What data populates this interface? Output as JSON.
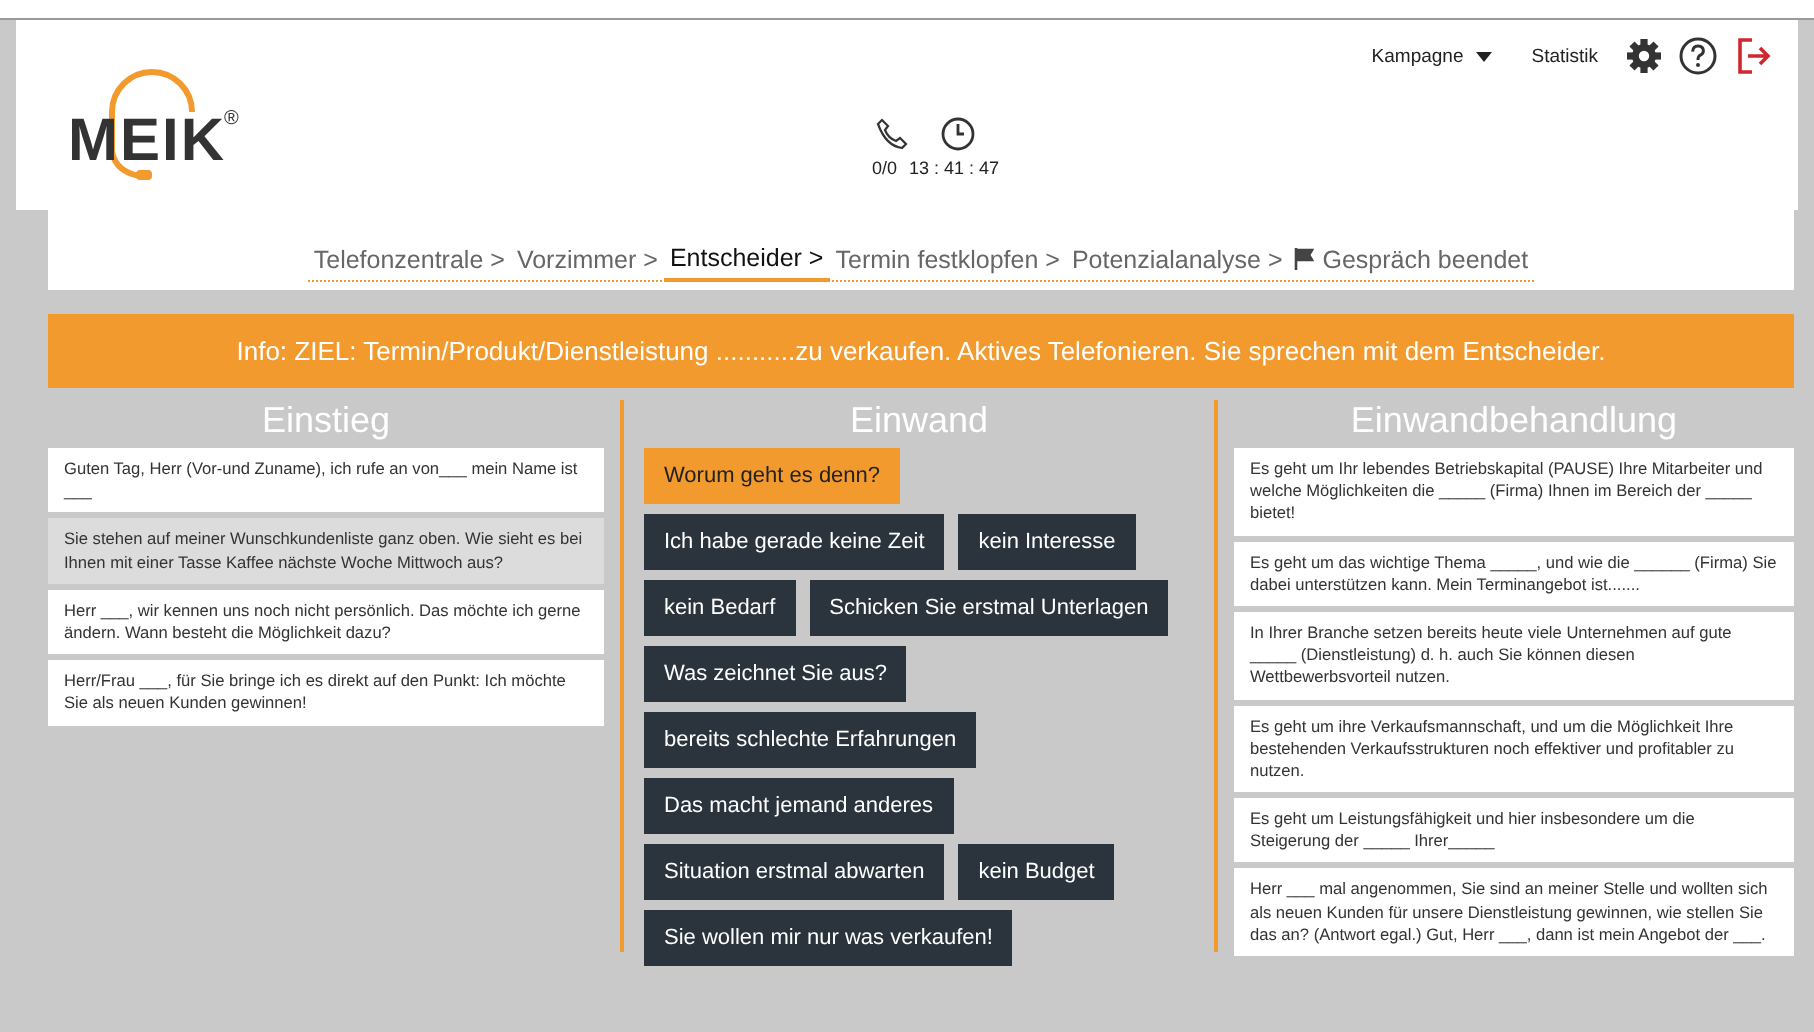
{
  "header": {
    "logo": "MEIK",
    "logo_mark": "®",
    "calls": "0/0",
    "timer": "13 : 41 : 47",
    "menu": [
      {
        "label": "Kampagne",
        "kind": "dropdown"
      },
      {
        "label": "Statistik",
        "kind": "link"
      }
    ]
  },
  "steps": [
    {
      "label": "Telefonzentrale >",
      "selected": false,
      "kind": "step"
    },
    {
      "label": "Vorzimmer >",
      "selected": false,
      "kind": "step"
    },
    {
      "label": "Entscheider >",
      "selected": true,
      "kind": "step"
    },
    {
      "label": "Termin festklopfen >",
      "selected": false,
      "kind": "step"
    },
    {
      "label": "Potenzialanalyse >",
      "selected": false,
      "kind": "step"
    },
    {
      "label": "Gespräch beendet",
      "selected": false,
      "kind": "end"
    }
  ],
  "info": "Info: ZIEL: Termin/Produkt/Dienstleistung ...........zu verkaufen. Aktives Telefonieren. Sie sprechen mit dem Entscheider.",
  "einstieg": {
    "title": "Einstieg",
    "items": [
      {
        "text": "Guten Tag, Herr (Vor-und Zuname), ich rufe an von___ mein Name ist ___",
        "selected": false
      },
      {
        "text": "Sie stehen auf meiner Wunschkundenliste ganz oben. Wie sieht es bei Ihnen mit einer Tasse Kaffee nächste Woche Mittwoch aus?",
        "selected": true
      },
      {
        "text": "Herr ___, wir kennen uns noch nicht persönlich. Das möchte ich gerne ändern. Wann besteht die Möglichkeit dazu?",
        "selected": false
      },
      {
        "text": "Herr/Frau ___, für Sie bringe ich es direkt auf den Punkt: Ich möchte Sie als neuen Kunden gewinnen!",
        "selected": false
      }
    ]
  },
  "einwand": {
    "title": "Einwand",
    "rows": [
      [
        {
          "label": "Worum geht es denn?",
          "selected": true
        }
      ],
      [
        {
          "label": "Ich habe gerade keine Zeit",
          "selected": false
        },
        {
          "label": "kein Interesse",
          "selected": false
        }
      ],
      [
        {
          "label": "kein Bedarf",
          "selected": false
        },
        {
          "label": "Schicken Sie erstmal Unterlagen",
          "selected": false
        }
      ],
      [
        {
          "label": "Was zeichnet Sie aus?",
          "selected": false
        }
      ],
      [
        {
          "label": "bereits schlechte Erfahrungen",
          "selected": false
        }
      ],
      [
        {
          "label": "Das macht jemand anderes",
          "selected": false
        }
      ],
      [
        {
          "label": "Situation erstmal abwarten",
          "selected": false
        },
        {
          "label": "kein Budget",
          "selected": false
        }
      ],
      [
        {
          "label": "Sie wollen mir nur was verkaufen!",
          "selected": false
        }
      ]
    ]
  },
  "behandlung": {
    "title": "Einwandbehandlung",
    "items": [
      "Es geht um Ihr lebendes Betriebskapital (PAUSE) Ihre Mitarbeiter und welche Möglichkeiten die _____ (Firma) Ihnen im Bereich der _____ bietet!",
      "Es geht um das wichtige Thema _____, und wie die ______ (Firma) Sie dabei unterstützen kann. Mein Terminangebot ist.......",
      "In Ihrer Branche setzen bereits heute viele Unternehmen auf gute _____ (Dienstleistung) d. h. auch Sie können diesen Wettbewerbsvorteil nutzen.",
      "Es geht um ihre Verkaufsmannschaft, und um die Möglichkeit Ihre bestehenden Verkaufsstrukturen noch effektiver und profitabler zu nutzen.",
      "Es geht um Leistungsfähigkeit und hier insbesondere um die Steigerung der _____ Ihrer_____",
      "Herr ___ mal angenommen, Sie sind an meiner Stelle und wollten sich als neuen Kunden für unsere Dienstleistung gewinnen, wie stellen Sie das an? (Antwort egal.) Gut, Herr ___, dann ist mein Angebot der ___."
    ]
  }
}
